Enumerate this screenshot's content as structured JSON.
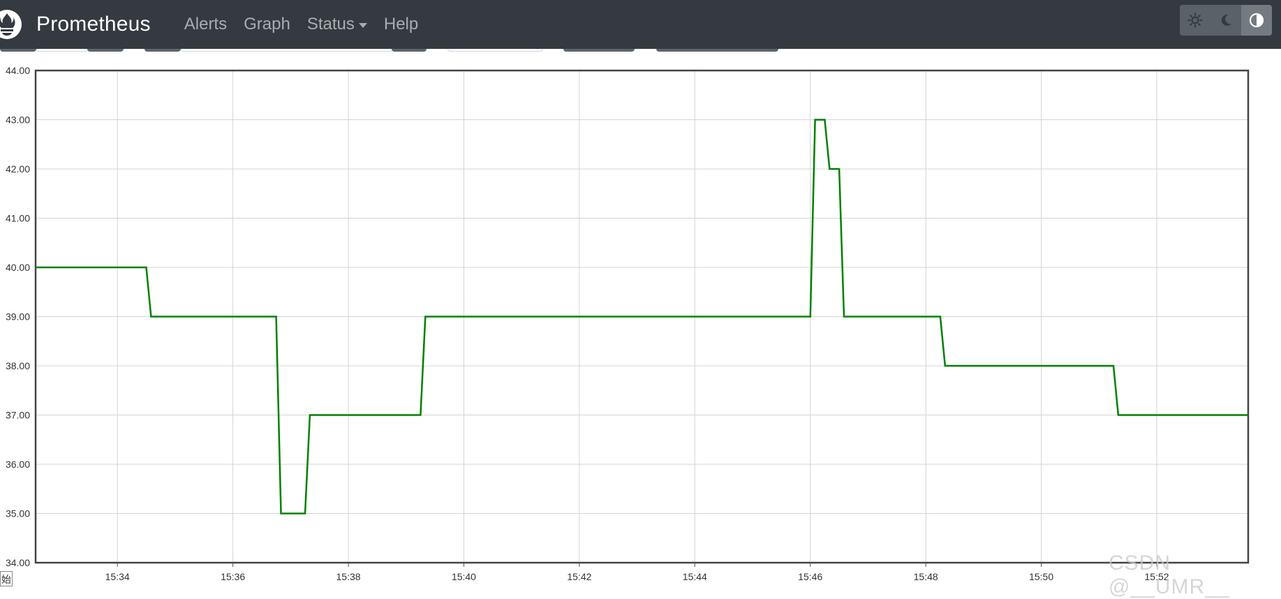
{
  "navbar": {
    "brand": "Prometheus",
    "links": [
      {
        "label": "Alerts"
      },
      {
        "label": "Graph"
      },
      {
        "label": "Status",
        "dropdown": true
      },
      {
        "label": "Help"
      }
    ],
    "theme_buttons": [
      {
        "icon": "sun-icon",
        "active": false
      },
      {
        "icon": "moon-icon",
        "active": false
      },
      {
        "icon": "contrast-icon",
        "active": true
      }
    ],
    "background": "#343a40"
  },
  "chart_data": {
    "type": "line",
    "title": "",
    "xlabel": "",
    "ylabel": "",
    "grid": true,
    "ylim": [
      34,
      44
    ],
    "y_ticks": [
      "34.00",
      "35.00",
      "36.00",
      "37.00",
      "38.00",
      "39.00",
      "40.00",
      "41.00",
      "42.00",
      "43.00",
      "44.00"
    ],
    "x_ticks": [
      "15:34",
      "15:36",
      "15:38",
      "15:40",
      "15:42",
      "15:44",
      "15:46",
      "15:48",
      "15:50",
      "15:52"
    ],
    "x_range": [
      "15:32:35",
      "15:53:35"
    ],
    "series": [
      {
        "color": "#008000",
        "points": [
          [
            "15:32:35",
            40
          ],
          [
            "15:34:30",
            40
          ],
          [
            "15:34:35",
            39
          ],
          [
            "15:36:45",
            39
          ],
          [
            "15:36:50",
            35
          ],
          [
            "15:37:15",
            35
          ],
          [
            "15:37:20",
            37
          ],
          [
            "15:39:15",
            37
          ],
          [
            "15:39:20",
            39
          ],
          [
            "15:46:00",
            39
          ],
          [
            "15:46:05",
            43
          ],
          [
            "15:46:15",
            43
          ],
          [
            "15:46:20",
            42
          ],
          [
            "15:46:30",
            42
          ],
          [
            "15:46:35",
            39
          ],
          [
            "15:48:15",
            39
          ],
          [
            "15:48:20",
            38
          ],
          [
            "15:51:15",
            38
          ],
          [
            "15:51:20",
            37
          ],
          [
            "15:53:35",
            37
          ]
        ]
      }
    ]
  },
  "watermark": "CSDN @__UMR__",
  "corner_glyph": "始"
}
